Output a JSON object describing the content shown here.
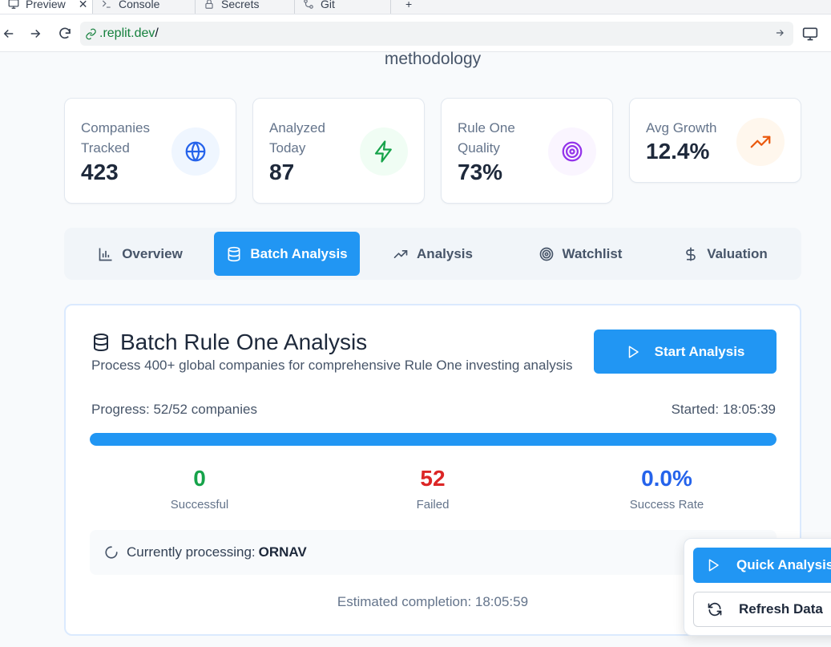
{
  "browser": {
    "tabs": [
      {
        "label": "Preview",
        "icon": "monitor-icon"
      },
      {
        "label": "Console",
        "icon": "terminal-icon"
      },
      {
        "label": "Secrets",
        "icon": "lock-icon"
      },
      {
        "label": "Git",
        "icon": "git-icon"
      }
    ],
    "new_tab_label": "+",
    "url_host": ".replit.dev",
    "url_path": "/"
  },
  "page": {
    "subtitle": "methodology"
  },
  "stats": [
    {
      "label": "Companies Tracked",
      "value": "423",
      "icon": "globe-icon",
      "color": "#2563eb",
      "bg": "#eff6ff"
    },
    {
      "label": "Analyzed Today",
      "value": "87",
      "icon": "zap-icon",
      "color": "#16a34a",
      "bg": "#f0fdf4"
    },
    {
      "label": "Rule One Quality",
      "value": "73%",
      "icon": "target-icon",
      "color": "#9333ea",
      "bg": "#faf5ff"
    },
    {
      "label": "Avg Growth",
      "value": "12.4%",
      "icon": "trending-up-icon",
      "color": "#ea580c",
      "bg": "#fff7ed"
    }
  ],
  "tabs": [
    {
      "label": "Overview",
      "icon": "bar-chart-icon",
      "active": false
    },
    {
      "label": "Batch Analysis",
      "icon": "database-icon",
      "active": true
    },
    {
      "label": "Analysis",
      "icon": "trending-up-icon",
      "active": false
    },
    {
      "label": "Watchlist",
      "icon": "target-icon",
      "active": false
    },
    {
      "label": "Valuation",
      "icon": "dollar-icon",
      "active": false
    }
  ],
  "batch": {
    "title": "Batch Rule One Analysis",
    "description": "Process 400+ global companies for comprehensive Rule One investing analysis",
    "start_button": "Start Analysis",
    "progress_text": "Progress: 52/52 companies",
    "started_text": "Started: 18:05:39",
    "progress_fraction": 1.0,
    "metrics": [
      {
        "value": "0",
        "caption": "Successful",
        "color": "#16a34a"
      },
      {
        "value": "52",
        "caption": "Failed",
        "color": "#dc2626"
      },
      {
        "value": "0.0%",
        "caption": "Success Rate",
        "color": "#2563eb"
      }
    ],
    "processing_label": "Currently processing:",
    "processing_ticker": "ORNAV",
    "eta_text": "Estimated completion: 18:05:59"
  },
  "floating": {
    "quick_label": "Quick Analysis",
    "refresh_label": "Refresh Data"
  },
  "colors": {
    "accent": "#2196f3"
  }
}
